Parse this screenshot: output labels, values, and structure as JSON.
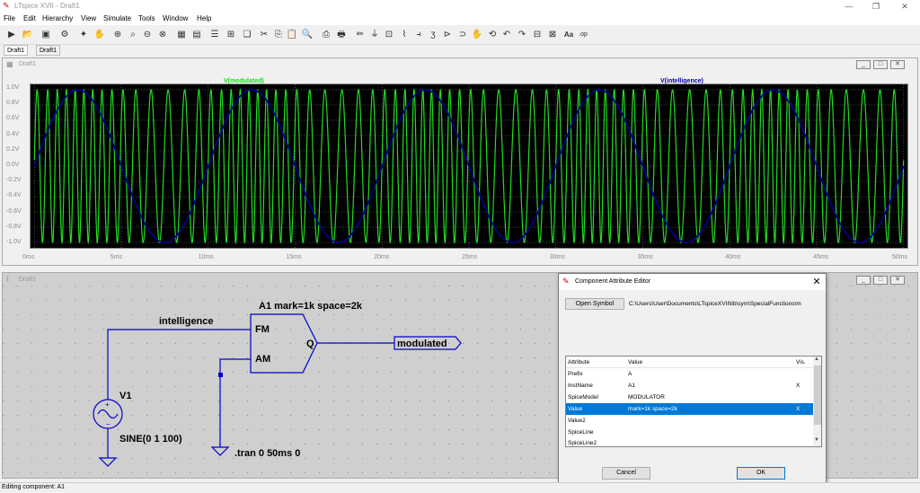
{
  "app": {
    "title": "LTspice XVII - Draft1"
  },
  "menu": [
    "File",
    "Edit",
    "Hierarchy",
    "View",
    "Simulate",
    "Tools",
    "Window",
    "Help"
  ],
  "tabs": [
    {
      "label": "Draft1"
    },
    {
      "label": "Draft1"
    }
  ],
  "wave_window": {
    "title": "Draft1"
  },
  "chart_data": {
    "type": "line",
    "series": [
      {
        "name": "V(modulated)",
        "color": "#22dd22",
        "description_values": "FM sine, amplitude 1, frequency between 1 kHz and 2 kHz"
      },
      {
        "name": "V(intelligence)",
        "color": "#00008b",
        "frequency_hz": 100,
        "amplitude": 1
      }
    ],
    "xlim_ms": [
      0,
      50
    ],
    "ylim": [
      -1.0,
      1.0
    ],
    "x_ticks": [
      "0ms",
      "5ms",
      "10ms",
      "15ms",
      "20ms",
      "25ms",
      "30ms",
      "35ms",
      "40ms",
      "45ms",
      "50ms"
    ],
    "y_ticks": [
      "1.0V",
      "0.8V",
      "0.6V",
      "0.4V",
      "0.2V",
      "0.0V",
      "-0.2V",
      "-0.4V",
      "-0.6V",
      "-0.8V",
      "-1.0V"
    ],
    "grid": true
  },
  "schematic": {
    "title": "Draft1",
    "component_label": "A1  mark=1k space=2k",
    "pin_fm": "FM",
    "pin_am": "AM",
    "pin_q": "Q",
    "net_intelligence": "intelligence",
    "net_modulated": "modulated",
    "source_name": "V1",
    "source_value": "SINE(0 1 100)",
    "directive": ".tran 0 50ms 0"
  },
  "dialog": {
    "title": "Component Attribute Editor",
    "open_symbol": "Open Symbol",
    "symbol_path": "C:\\Users\\User\\Documents\\LTspiceXVII\\lib\\sym\\SpecialFunctions\\m",
    "headers": {
      "attribute": "Attribute",
      "value": "Value",
      "vis": "Vis."
    },
    "rows": [
      {
        "attribute": "Prefix",
        "value": "A",
        "vis": ""
      },
      {
        "attribute": "InstName",
        "value": "A1",
        "vis": "X"
      },
      {
        "attribute": "SpiceModel",
        "value": "MODULATOR",
        "vis": ""
      },
      {
        "attribute": "Value",
        "value": "mark=1k space=2k",
        "vis": "X"
      },
      {
        "attribute": "Value2",
        "value": "",
        "vis": ""
      },
      {
        "attribute": "SpiceLine",
        "value": "",
        "vis": ""
      },
      {
        "attribute": "SpiceLine2",
        "value": "",
        "vis": ""
      }
    ],
    "cancel": "Cancel",
    "ok": "OK"
  },
  "status": "Editing component: A1"
}
